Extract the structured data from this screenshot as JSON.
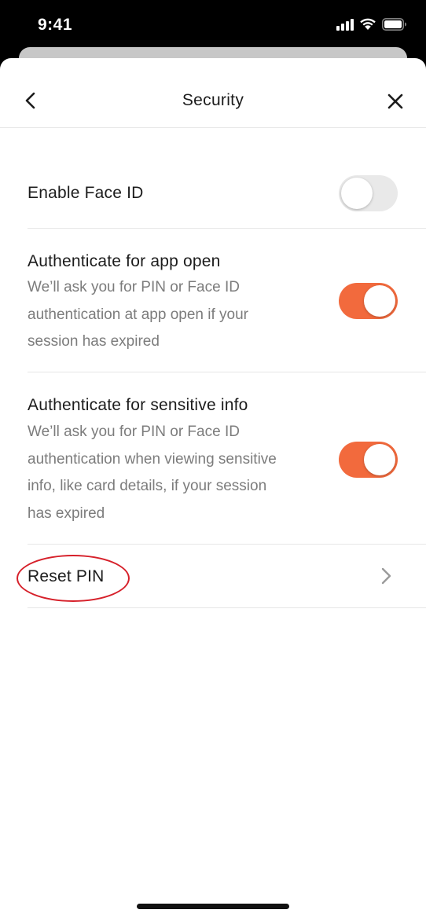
{
  "status_bar": {
    "time": "9:41",
    "icons": [
      "cellular-signal-icon",
      "wifi-icon",
      "battery-icon"
    ]
  },
  "header": {
    "title": "Security",
    "back_icon": "chevron-left-icon",
    "close_icon": "close-icon"
  },
  "settings": {
    "face_id": {
      "title": "Enable Face ID",
      "enabled": false
    },
    "app_open": {
      "title": "Authenticate for app open",
      "desc_line1": "We’ll ask you for PIN or Face ID",
      "desc_line2": "authentication at app open if your",
      "desc_line3": "session has expired",
      "enabled": true
    },
    "sensitive_info": {
      "title": "Authenticate for sensitive info",
      "desc_line1": "We’ll ask you for PIN or Face ID",
      "desc_line2": "authentication when viewing sensitive",
      "desc_line3": "info, like card details, if your session",
      "desc_line4": "has expired",
      "enabled": true
    },
    "reset_pin": {
      "title": "Reset PIN",
      "icon": "chevron-right-icon"
    }
  },
  "colors": {
    "accent": "#f26a3d",
    "toggle_off": "#e9e9e9",
    "annotation": "#d6202a"
  }
}
